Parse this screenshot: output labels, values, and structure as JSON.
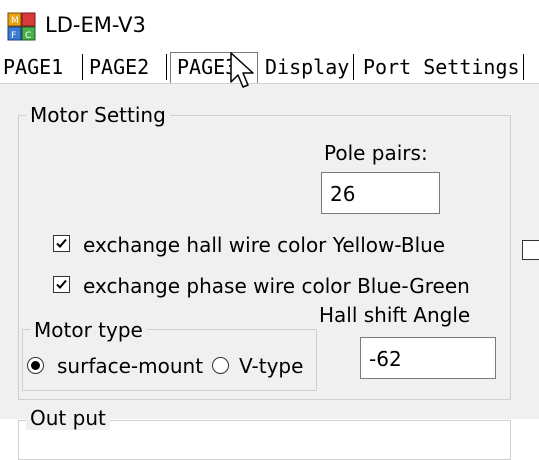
{
  "window": {
    "title": "LD-EM-V3",
    "icon": "app-blocks-icon"
  },
  "tabs": [
    {
      "label": "PAGE1",
      "active": false
    },
    {
      "label": "PAGE2",
      "active": false
    },
    {
      "label": "PAGE3",
      "active": true
    },
    {
      "label": "Display",
      "active": false
    },
    {
      "label": "Port Settings",
      "active": false
    }
  ],
  "motor_setting": {
    "legend": "Motor Setting",
    "pole_pairs": {
      "label": "Pole pairs:",
      "value": "26"
    },
    "exchange_hall": {
      "label": "exchange hall wire color Yellow-Blue",
      "checked": true
    },
    "exchange_phase": {
      "label": "exchange phase wire color Blue-Green",
      "checked": true
    },
    "hall_shift": {
      "label": "Hall shift Angle",
      "value": "-62"
    },
    "motor_type": {
      "legend": "Motor type",
      "options": [
        {
          "label": "surface-mount",
          "selected": true
        },
        {
          "label": "V-type",
          "selected": false
        }
      ]
    }
  },
  "output_group": {
    "legend": "Out put"
  },
  "colors": {
    "page_bg": "#f0f0f0",
    "group_border": "#cfcfcf",
    "field_border": "#7a7a7a"
  }
}
